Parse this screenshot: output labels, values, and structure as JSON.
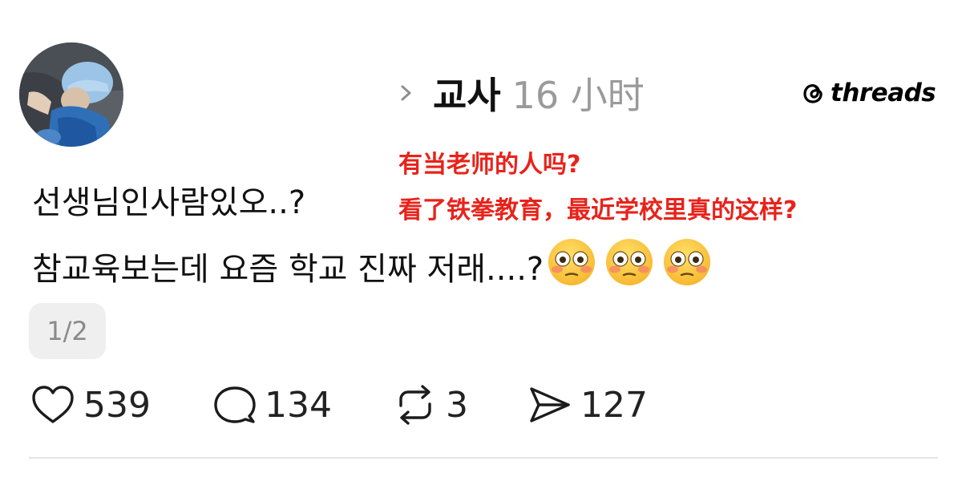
{
  "post": {
    "topic_chevron_icon": "chevron-right-icon",
    "topic": "교사",
    "time": "16 小时",
    "body_line1": "선생님인사람있오..?",
    "body_line2": "참교육보는데 요즘 학교 진짜 저래....?",
    "emojis": [
      "flushed-face-icon",
      "flushed-face-icon",
      "flushed-face-icon"
    ],
    "page_indicator": "1/2"
  },
  "brand": {
    "icon": "threads-logo-icon",
    "name": "threads"
  },
  "annotation": {
    "line1": "有当老师的人吗?",
    "line2": "看了铁拳教育，最近学校里真的这样?",
    "color": "#e8231b"
  },
  "actions": {
    "likes": "539",
    "comments": "134",
    "reposts": "3",
    "shares": "127"
  }
}
